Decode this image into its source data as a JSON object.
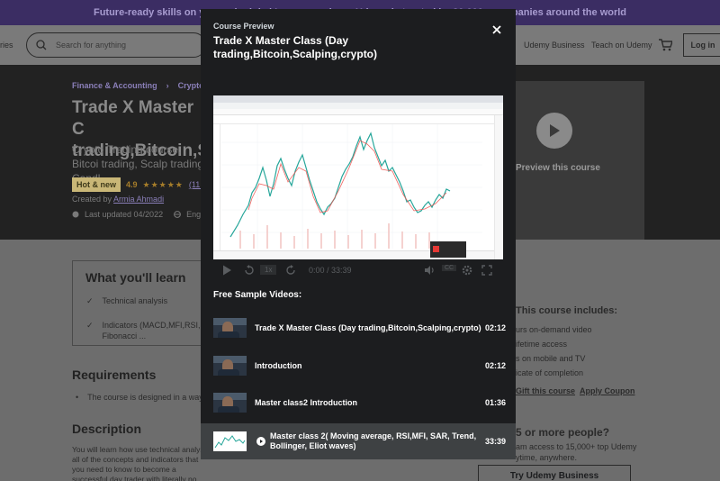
{
  "banner": {
    "text": "Future-ready skills on your schedule | Learn anywhere. Udemy is trusted by 30,000+ companies around the world"
  },
  "topnav": {
    "categories_label": "ries",
    "search_placeholder": "Search for anything",
    "udemy_business": "Udemy Business",
    "teach": "Teach on Udemy",
    "login": "Log in"
  },
  "course": {
    "breadcrumb": [
      "Finance & Accounting",
      "Cryptocurr"
    ],
    "title": "Trade X Master C trading,Bitcoin,S",
    "subtitle": "Crypto Trading course, Bitcoi trading, Scalp trading, Candl",
    "badge": "Hot & new",
    "rating": "4.9",
    "stars": "★★★★★",
    "rating_count": "(11 rating",
    "created_prefix": "Created by",
    "author": "Armia Ahmadi",
    "last_updated": "Last updated 04/2022",
    "language": "Englis",
    "preview_label": "Preview this course"
  },
  "learn": {
    "title": "What you'll learn",
    "items": [
      "Technical analysis",
      "Indicators (MACD,MFI,RSI, Ich",
      "Fibonacci ..."
    ]
  },
  "requirements": {
    "title": "Requirements",
    "items": [
      "The course is designed in a way t"
    ]
  },
  "description": {
    "title": "Description",
    "text": "You will learn how use technical analysi all of the concepts and indicators that you need to know to become a successful day trader with literally no experience in the past."
  },
  "sidebar": {
    "includes_title": "This course includes:",
    "items": [
      "urs on-demand video",
      "ifetime access",
      "s on mobile and TV",
      "icate of completion"
    ],
    "gift": "Gift this course",
    "coupon": "Apply Coupon",
    "team_title": "5 or more people?",
    "team_text": "am access to 15,000+ top Udemy",
    "team_text2": "ytime, anywhere.",
    "try_button": "Try Udemy Business"
  },
  "modal": {
    "kicker": "Course Preview",
    "title": "Trade X Master Class (Day trading,Bitcoin,Scalping,crypto)",
    "player": {
      "speed": "1x",
      "time": "0:00 / 33:39",
      "progress": 0
    },
    "samples_heading": "Free Sample Videos:",
    "videos": [
      {
        "title": "Trade X Master Class (Day trading,Bitcoin,Scalping,crypto)",
        "duration": "02:12"
      },
      {
        "title": "Introduction",
        "duration": "02:12"
      },
      {
        "title": "Master class2 Introduction",
        "duration": "01:36"
      },
      {
        "title": "Master class 2( Moving average, RSI,MFI, SAR, Trend, Bollinger, Eliot waves)",
        "duration": "33:39"
      }
    ],
    "active_index": 3
  },
  "colors": {
    "modal_bg": "#1c1d1f",
    "active_row": "#3e4143",
    "overlay": "#6d6d6d",
    "link_purple": "#8a7fb8",
    "badge": "#c9b777"
  },
  "icons": [
    "close-icon",
    "search-icon",
    "cart-icon",
    "play-icon",
    "rewind-icon",
    "forward-icon",
    "volume-icon",
    "captions-icon",
    "gear-icon",
    "fullscreen-icon",
    "check-icon",
    "globe-icon",
    "alert-icon"
  ]
}
